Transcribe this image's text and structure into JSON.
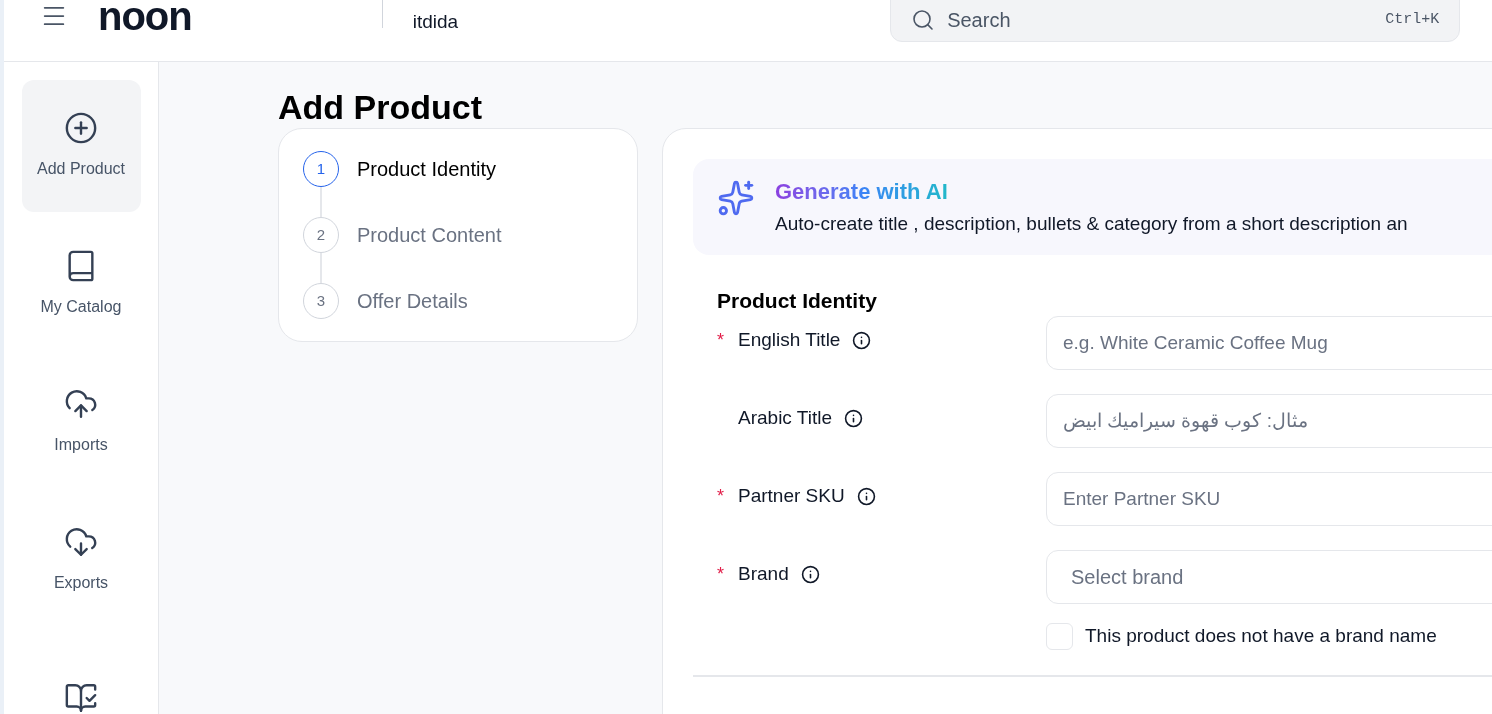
{
  "header": {
    "logo": "noon",
    "store_name": "itdida",
    "search": {
      "placeholder": "Search",
      "shortcut": "Ctrl+K"
    }
  },
  "sidebar": {
    "items": [
      {
        "label": "Add Product",
        "selected": true
      },
      {
        "label": "My Catalog",
        "selected": false
      },
      {
        "label": "Imports",
        "selected": false
      },
      {
        "label": "Exports",
        "selected": false
      },
      {
        "selected": false
      }
    ]
  },
  "page_title": "Add Product",
  "steps": [
    {
      "number": "1",
      "label": "Product Identity",
      "selected": true
    },
    {
      "number": "2",
      "label": "Product Content",
      "selected": false
    },
    {
      "number": "3",
      "label": "Offer Details",
      "selected": false
    }
  ],
  "ai_banner": {
    "title": "Generate with AI",
    "description": "Auto-create title , description, bullets & category from a short description an"
  },
  "form": {
    "section_title": "Product Identity",
    "required_mark": "*",
    "fields": [
      {
        "kind": "input",
        "label": "English Title",
        "required": true,
        "placeholder": "e.g. White Ceramic Coffee Mug"
      },
      {
        "kind": "rtl-input",
        "label": "Arabic Title",
        "required": false,
        "placeholder": "مثال: كوب قهوة سيراميك ابيض"
      },
      {
        "kind": "input",
        "label": "Partner SKU",
        "required": true,
        "placeholder": "Enter Partner SKU"
      },
      {
        "kind": "select",
        "label": "Brand",
        "required": true,
        "placeholder": "Select brand"
      }
    ],
    "no_brand": {
      "label": "This product does not have a brand name",
      "checked": false
    }
  }
}
